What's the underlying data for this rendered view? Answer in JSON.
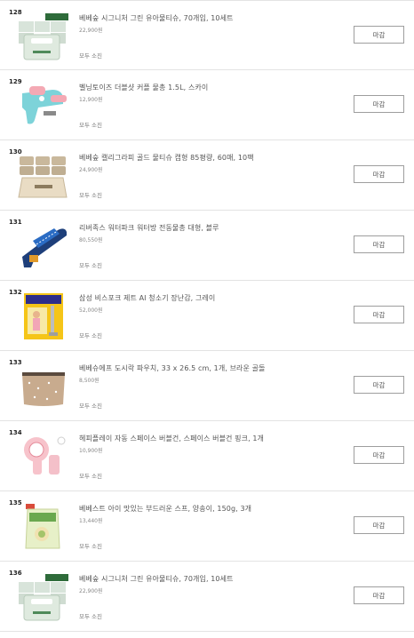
{
  "items": [
    {
      "rank": "128",
      "name": "베베숲 시그니처 그린 유아물티슈, 70개입, 10세트",
      "price": "22,900원",
      "stock": "모두 소진",
      "button": "마감",
      "icon": "wet-wipes-pack-icon"
    },
    {
      "rank": "129",
      "name": "벨닝토이즈 더블샷 커플 물총 1.5L, 스카이",
      "price": "12,900원",
      "stock": "모두 소진",
      "button": "마감",
      "icon": "water-gun-icon"
    },
    {
      "rank": "130",
      "name": "베베숲 캘리그라피 골드 물티슈 캡형 85평량, 60매, 10팩",
      "price": "24,900원",
      "stock": "모두 소진",
      "button": "마감",
      "icon": "wet-wipes-box-icon"
    },
    {
      "rank": "131",
      "name": "리버족스 워터파크 워터방 전동물총 대형, 블루",
      "price": "80,550원",
      "stock": "모두 소진",
      "button": "마감",
      "icon": "electric-water-gun-icon"
    },
    {
      "rank": "132",
      "name": "삼성 비스포크 제트 AI 청소기 장난감, 그레이",
      "price": "52,000원",
      "stock": "모두 소진",
      "button": "마감",
      "icon": "toy-vacuum-box-icon"
    },
    {
      "rank": "133",
      "name": "베베슈에프 도시락 파우치, 33 x 26.5 cm, 1개, 브라운 골돌",
      "price": "8,500원",
      "stock": "모두 소진",
      "button": "마감",
      "icon": "lunch-pouch-icon"
    },
    {
      "rank": "134",
      "name": "헤피플레이 자동 스페이스 버블건, 스페이스 버블건 핑크, 1개",
      "price": "10,900원",
      "stock": "모두 소진",
      "button": "마감",
      "icon": "bubble-gun-icon"
    },
    {
      "rank": "135",
      "name": "베베스트 아이 맛있는 부드러운 스프, 양송이, 150g, 3개",
      "price": "13,440원",
      "stock": "모두 소진",
      "button": "마감",
      "icon": "baby-soup-pouch-icon"
    },
    {
      "rank": "136",
      "name": "베베숲 시그니처 그린 유아물티슈, 70개입, 10세트",
      "price": "22,900원",
      "stock": "모두 소진",
      "button": "마감",
      "icon": "wet-wipes-pack-icon"
    }
  ]
}
